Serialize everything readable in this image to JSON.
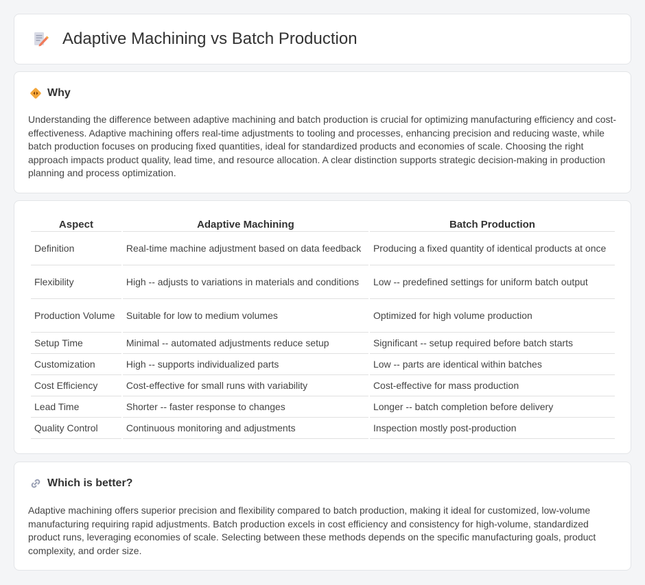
{
  "header": {
    "title": "Adaptive Machining vs Batch Production",
    "icon": "document-pencil-icon"
  },
  "why": {
    "heading": "Why",
    "icon": "diamond-arrows-icon",
    "text": "Understanding the difference between adaptive machining and batch production is crucial for optimizing manufacturing efficiency and cost-effectiveness. Adaptive machining offers real-time adjustments to tooling and processes, enhancing precision and reducing waste, while batch production focuses on producing fixed quantities, ideal for standardized products and economies of scale. Choosing the right approach impacts product quality, lead time, and resource allocation. A clear distinction supports strategic decision-making in production planning and process optimization."
  },
  "table": {
    "headers": [
      "Aspect",
      "Adaptive Machining",
      "Batch Production"
    ],
    "rows": [
      [
        "Definition",
        "Real-time machine adjustment based on data feedback",
        "Producing a fixed quantity of identical products at once"
      ],
      [
        "Flexibility",
        "High -- adjusts to variations in materials and conditions",
        "Low -- predefined settings for uniform batch output"
      ],
      [
        "Production Volume",
        "Suitable for low to medium volumes",
        "Optimized for high volume production"
      ],
      [
        "Setup Time",
        "Minimal -- automated adjustments reduce setup",
        "Significant -- setup required before batch starts"
      ],
      [
        "Customization",
        "High -- supports individualized parts",
        "Low -- parts are identical within batches"
      ],
      [
        "Cost Efficiency",
        "Cost-effective for small runs with variability",
        "Cost-effective for mass production"
      ],
      [
        "Lead Time",
        "Shorter -- faster response to changes",
        "Longer -- batch completion before delivery"
      ],
      [
        "Quality Control",
        "Continuous monitoring and adjustments",
        "Inspection mostly post-production"
      ]
    ]
  },
  "better": {
    "heading": "Which is better?",
    "icon": "link-icon",
    "text": "Adaptive machining offers superior precision and flexibility compared to batch production, making it ideal for customized, low-volume manufacturing requiring rapid adjustments. Batch production excels in cost efficiency and consistency for high-volume, standardized product runs, leveraging economies of scale. Selecting between these methods depends on the specific manufacturing goals, product complexity, and order size."
  },
  "colors": {
    "background": "#f4f5f7",
    "card": "#ffffff",
    "text": "#333333",
    "icon_orange": "#f4a63a",
    "icon_pink": "#e86a6a"
  }
}
